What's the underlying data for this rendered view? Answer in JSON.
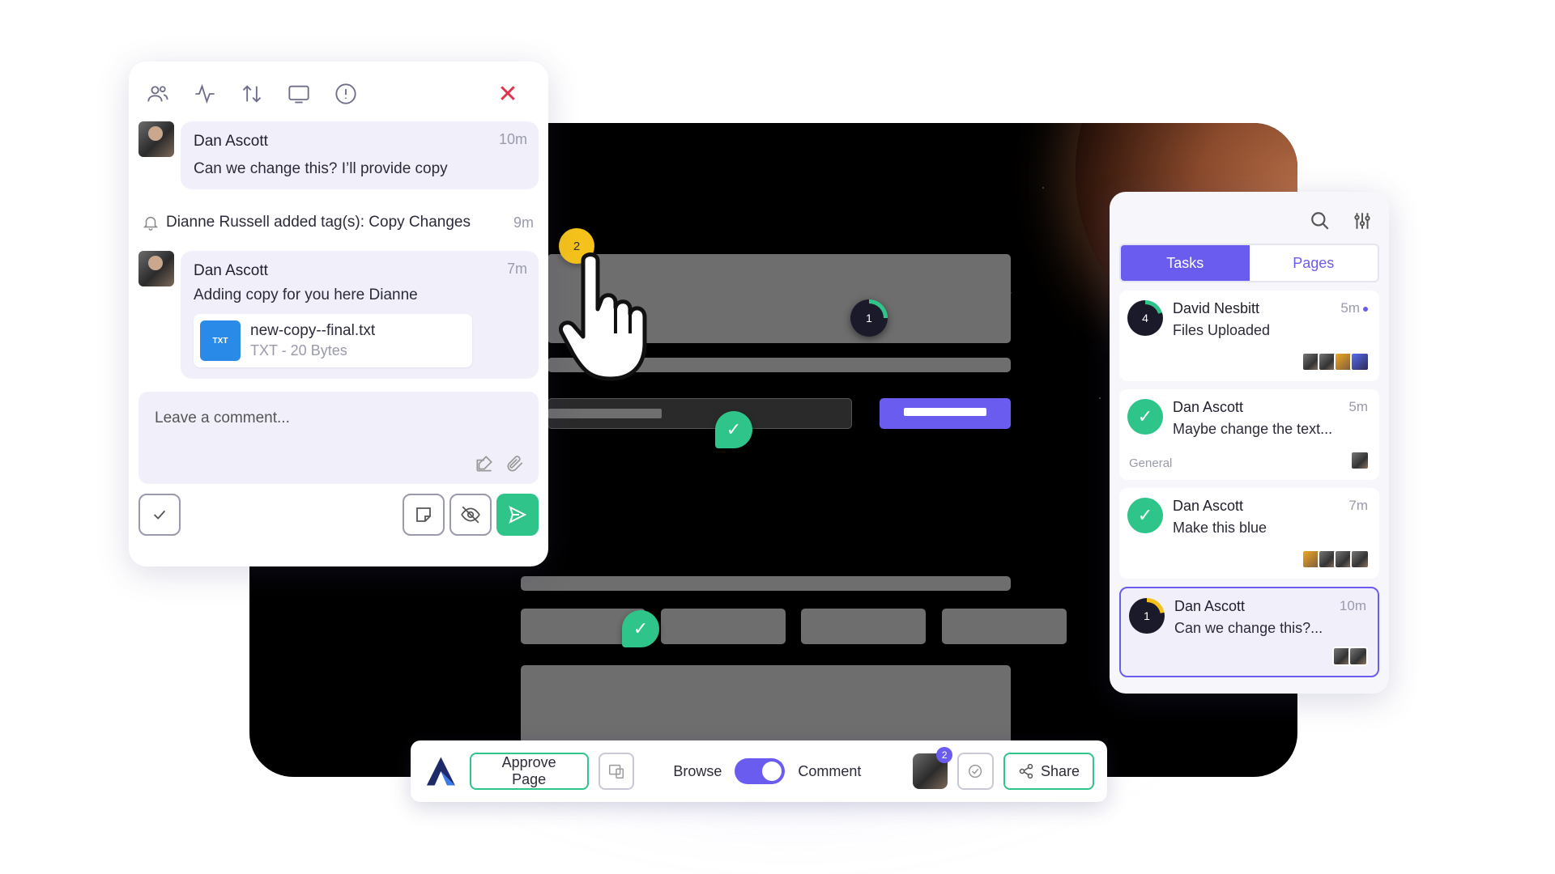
{
  "comments_panel": {
    "toolbar_icons": [
      "users-icon",
      "activity-icon",
      "sort-icon",
      "screen-icon",
      "info-icon",
      "close-icon"
    ],
    "messages": [
      {
        "author": "Dan Ascott",
        "time": "10m",
        "text": "Can we change this? I’ll provide copy"
      },
      {
        "author": "Dan Ascott",
        "time": "7m",
        "text": "Adding copy for you here Dianne",
        "attachment": {
          "name": "new-copy--final.txt",
          "meta": "TXT - 20 Bytes",
          "type_label": "TXT"
        }
      }
    ],
    "activity": {
      "text": "Dianne Russell added tag(s): Copy Changes",
      "time": "9m"
    },
    "comment_input": {
      "placeholder": "Leave a comment...",
      "value": ""
    }
  },
  "canvas": {
    "markers": [
      {
        "label": "2",
        "color": "#f5c21b"
      },
      {
        "label": "1",
        "color": "#1a1a2a"
      }
    ]
  },
  "tasks_panel": {
    "tabs": [
      {
        "label": "Tasks",
        "active": true
      },
      {
        "label": "Pages",
        "active": false
      }
    ],
    "cards": [
      {
        "status": "4",
        "name": "David Nesbitt",
        "time": "5m",
        "text": "Files Uploaded",
        "unread": true
      },
      {
        "status": "done",
        "name": "Dan Ascott",
        "time": "5m",
        "text": "Maybe change the text...",
        "tag": "General"
      },
      {
        "status": "done",
        "name": "Dan Ascott",
        "time": "7m",
        "text": "Make this blue"
      },
      {
        "status": "1",
        "name": "Dan Ascott",
        "time": "10m",
        "text": "Can we change this?...",
        "selected": true
      }
    ]
  },
  "bottom_bar": {
    "approve_label": "Approve Page",
    "mode_left": "Browse",
    "mode_right": "Comment",
    "mode_active": "Comment",
    "user_badge": "2",
    "share_label": "Share"
  },
  "colors": {
    "accent": "#6b5cf0",
    "success": "#2ec48a",
    "danger": "#e0334d",
    "warning": "#f5c21b"
  }
}
